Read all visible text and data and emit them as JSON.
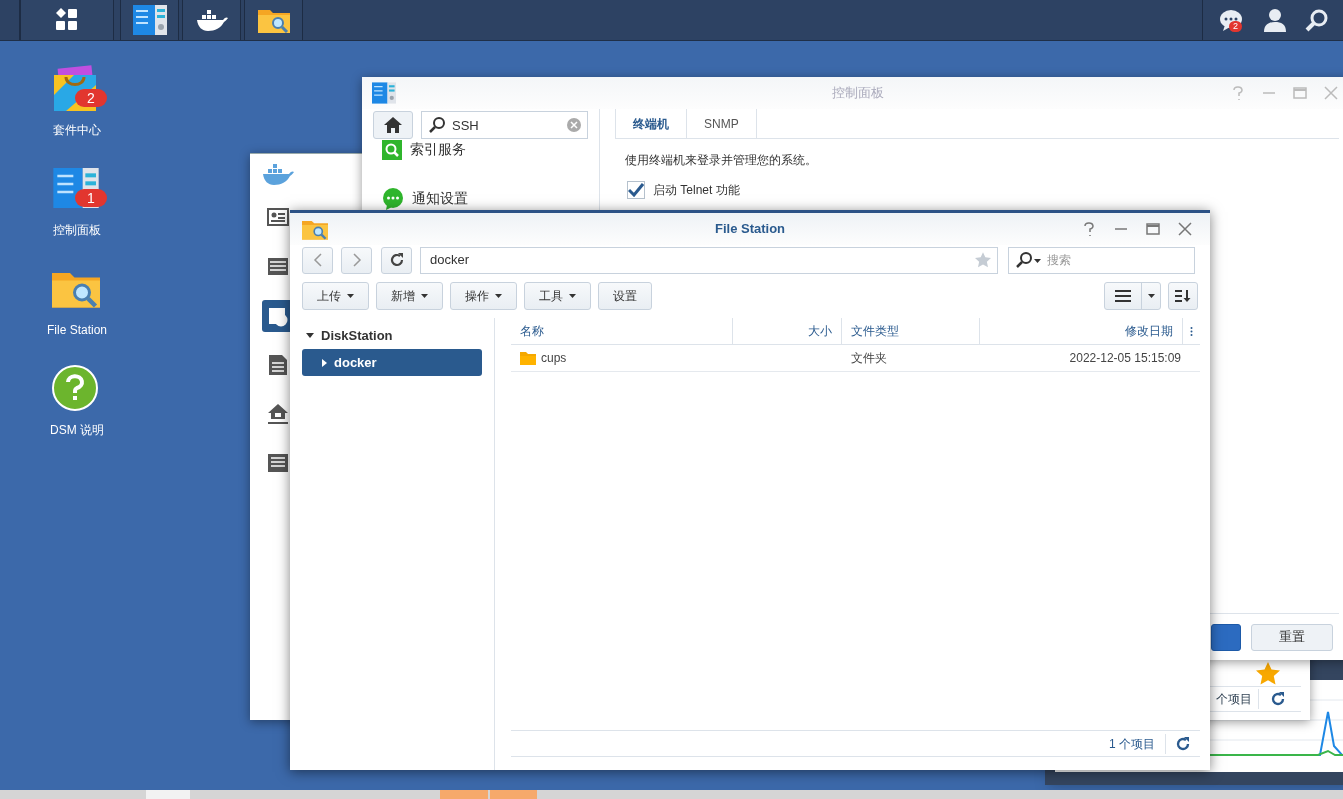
{
  "taskbar": {
    "apps": [
      {
        "kind": "main-menu"
      },
      {
        "kind": "control-panel"
      },
      {
        "kind": "docker"
      },
      {
        "kind": "file-station"
      }
    ],
    "notification_badge": "2"
  },
  "desktop_icons": [
    {
      "kind": "package-center",
      "label": "套件中心",
      "badge": "2"
    },
    {
      "kind": "control-panel",
      "label": "控制面板",
      "badge": "1"
    },
    {
      "kind": "file-station",
      "label": "File Station"
    },
    {
      "kind": "help",
      "label": "DSM 说明"
    }
  ],
  "control_panel": {
    "title": "控制面板",
    "search": {
      "value": "SSH"
    },
    "nav_items": [
      {
        "kind": "index",
        "label": "索引服务"
      },
      {
        "kind": "notify",
        "label": "通知设置"
      }
    ],
    "tabs": [
      {
        "label": "终端机",
        "selected": true
      },
      {
        "label": "SNMP",
        "selected": false
      }
    ],
    "description": "使用终端机来登录并管理您的系统。",
    "options": [
      {
        "label": "启动 Telnet 功能",
        "checked": true
      }
    ],
    "buttons": [
      {
        "kind": "primary"
      },
      {
        "kind": "default",
        "label": "重置"
      }
    ]
  },
  "docker_window": {
    "nav_items": [
      {
        "kind": "overview",
        "selected": false
      },
      {
        "kind": "registry",
        "selected": false
      },
      {
        "kind": "image",
        "selected": true
      },
      {
        "kind": "container",
        "selected": false
      },
      {
        "kind": "network",
        "selected": false
      },
      {
        "kind": "log",
        "selected": false
      }
    ],
    "status": "个项目"
  },
  "file_station": {
    "title": "File Station",
    "path": "docker",
    "search": {
      "placeholder": "搜索"
    },
    "toolbar": [
      {
        "label": "上传",
        "dropdown": true
      },
      {
        "label": "新增",
        "dropdown": true
      },
      {
        "label": "操作",
        "dropdown": true
      },
      {
        "label": "工具",
        "dropdown": true
      },
      {
        "label": "设置",
        "dropdown": false
      }
    ],
    "tree": [
      {
        "label": "DiskStation",
        "expanded": true,
        "selected": false,
        "children": [
          {
            "label": "docker",
            "expanded": false,
            "selected": true
          }
        ]
      }
    ],
    "columns": [
      {
        "label": "名称"
      },
      {
        "label": "大小"
      },
      {
        "label": "文件类型"
      },
      {
        "label": "修改日期"
      }
    ],
    "rows": [
      {
        "name": "cups",
        "type": "文件夹",
        "modified": "2022-12-05 15:15:09"
      }
    ],
    "status": "1 个项目"
  }
}
